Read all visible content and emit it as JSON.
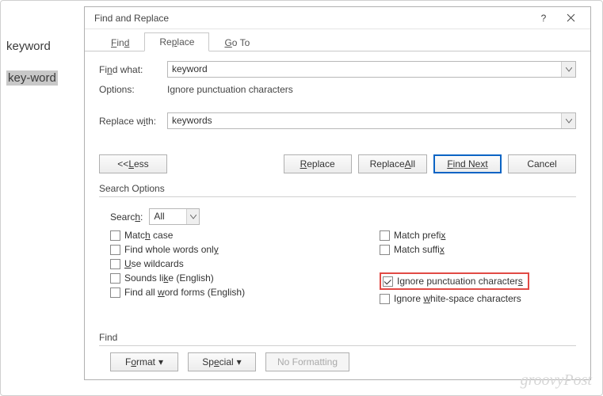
{
  "doc": {
    "word1": "keyword",
    "word2": "key-word"
  },
  "dialog": {
    "title": "Find and Replace",
    "tabs": {
      "find": "Find",
      "replace": "Replace",
      "goto": "Go To"
    },
    "find_what_label": "Find what:",
    "find_what_value": "keyword",
    "options_label": "Options:",
    "options_value": "Ignore punctuation characters",
    "replace_with_label": "Replace with:",
    "replace_with_value": "keywords",
    "buttons": {
      "less": "<< Less",
      "replace": "Replace",
      "replace_all": "Replace All",
      "find_next": "Find Next",
      "cancel": "Cancel"
    },
    "search_options_title": "Search Options",
    "search_label": "Search:",
    "search_value": "All",
    "checks_left": {
      "match": "Match case",
      "whole": "Find whole words only",
      "wild": "Use wildcards",
      "sounds": "Sounds like (English)",
      "forms": "Find all word forms (English)"
    },
    "checks_right": {
      "prefix": "Match prefix",
      "suffix": "Match suffix",
      "punct": "Ignore punctuation characters",
      "white": "Ignore white-space characters"
    },
    "find_title": "Find",
    "bottom": {
      "format": "Format",
      "special": "Special",
      "noformat": "No Formatting"
    }
  },
  "watermark": "groovyPost"
}
